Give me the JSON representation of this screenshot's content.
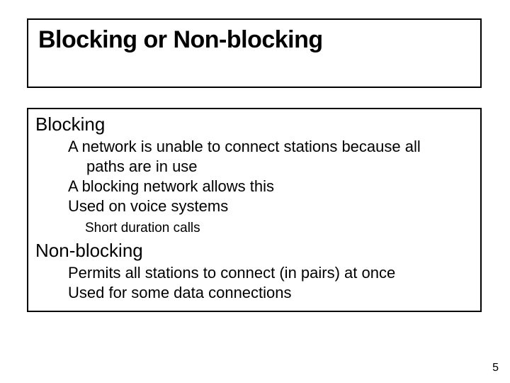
{
  "slide": {
    "title": "Blocking or Non-blocking",
    "section1": {
      "heading": "Blocking",
      "point1_line1": "A network is unable to connect stations because all",
      "point1_line2": "paths are in use",
      "point2": "A blocking network allows this",
      "point3": "Used on voice systems",
      "note1": "Short duration calls"
    },
    "section2": {
      "heading": "Non-blocking",
      "point1": "Permits all stations to connect (in pairs) at once",
      "point2": "Used for some data connections"
    },
    "page_number": "5"
  }
}
